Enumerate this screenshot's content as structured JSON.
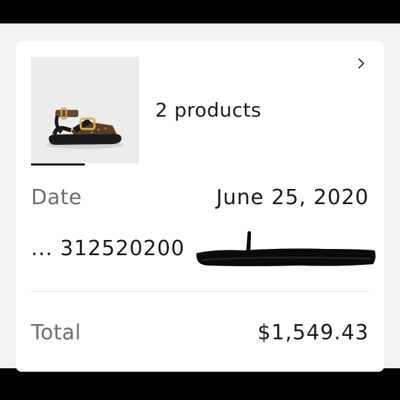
{
  "order": {
    "product_image_icon": "sandal-product-photo",
    "chevron_icon": "chevron-right-icon",
    "products_label": "2 products",
    "date_label": "Date",
    "date_value": "June 25, 2020",
    "order_number_visible": "... 312520200",
    "total_label": "Total",
    "total_value": "$1,549.43"
  },
  "colors": {
    "background_bars": "#000000",
    "screen_background": "#f2f2f2",
    "card_background": "#ffffff",
    "label_text": "#6e6e6e",
    "value_text": "#1a1a1a",
    "redaction_marker": "#0a0a0a"
  }
}
